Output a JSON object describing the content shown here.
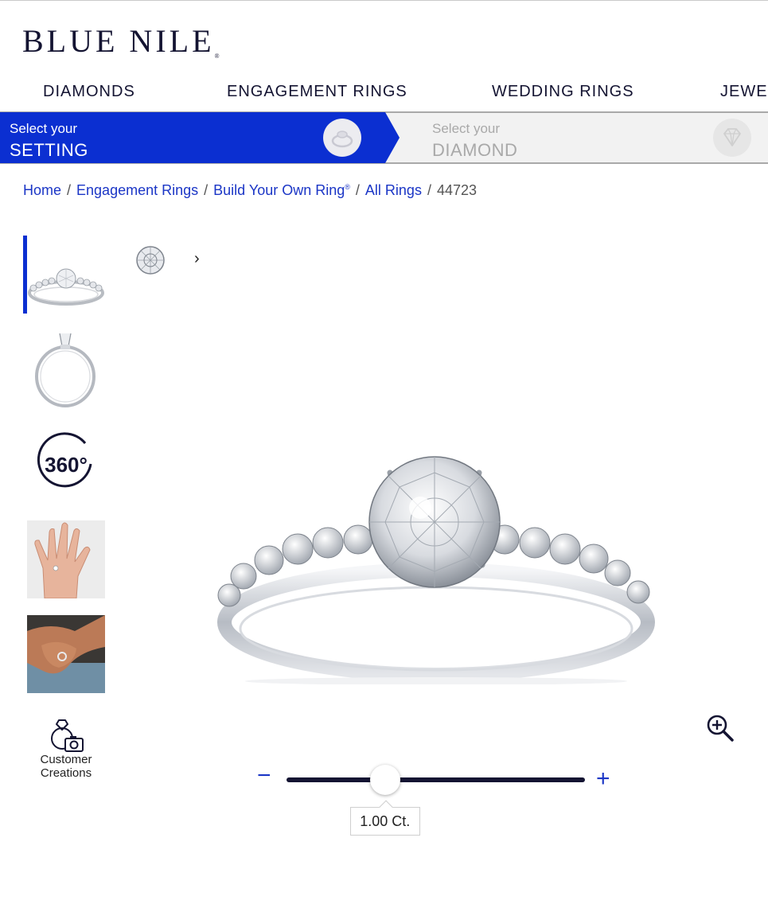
{
  "brand": {
    "logo_text": "BLUE NILE",
    "logo_mark": "®"
  },
  "nav": {
    "items": [
      {
        "label": "DIAMONDS"
      },
      {
        "label": "ENGAGEMENT RINGS"
      },
      {
        "label": "WEDDING RINGS"
      },
      {
        "label": "JEWELRY"
      }
    ]
  },
  "steps": {
    "step1": {
      "small": "Select your",
      "big": "SETTING",
      "active": true
    },
    "step2": {
      "small": "Select your",
      "big": "DIAMOND",
      "active": false
    },
    "accent_color": "#0b2fd1"
  },
  "breadcrumb": {
    "items": [
      {
        "label": "Home"
      },
      {
        "label": "Engagement Rings"
      },
      {
        "label": "Build Your Own Ring",
        "mark": "®"
      },
      {
        "label": "All Rings"
      }
    ],
    "current": "44723",
    "separator": "/"
  },
  "thumbnails": {
    "items": [
      {
        "icon": "ring-front-thumbnail",
        "active": true
      },
      {
        "icon": "ring-side-thumbnail"
      },
      {
        "icon": "360-view-icon",
        "label": "360°"
      },
      {
        "icon": "hand-model-thumbnail"
      },
      {
        "icon": "hand-lifestyle-thumbnail"
      }
    ],
    "customer_creations": {
      "line1": "Customer",
      "line2": "Creations"
    }
  },
  "viewer": {
    "zoom_icon": "zoom-in-icon"
  },
  "carat_slider": {
    "minus": "−",
    "plus": "+",
    "value_label": "1.00 Ct.",
    "position_fraction": 0.33
  }
}
